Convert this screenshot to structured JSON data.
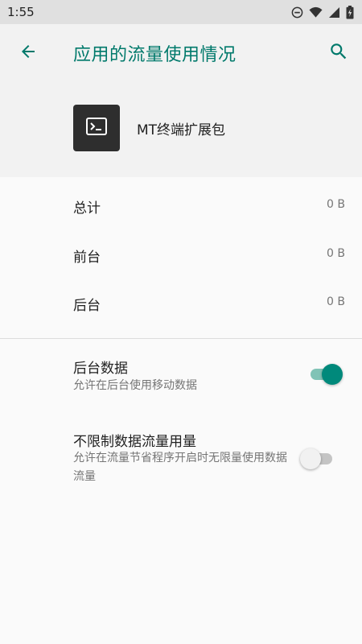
{
  "status_bar": {
    "time": "1:55",
    "icons": [
      "do-not-disturb-icon",
      "wifi-icon",
      "signal-icon",
      "battery-charging-icon"
    ]
  },
  "app_bar": {
    "title": "应用的流量使用情况",
    "back_icon": "arrow-back-icon",
    "search_icon": "search-icon",
    "accent_color": "#00796b"
  },
  "app_header": {
    "app_name": "MT终端扩展包",
    "icon": "terminal-icon"
  },
  "usage": [
    {
      "label": "总计",
      "value": "0 B"
    },
    {
      "label": "前台",
      "value": "0 B"
    },
    {
      "label": "后台",
      "value": "0 B"
    }
  ],
  "settings": {
    "background_data": {
      "title": "后台数据",
      "summary": "允许在后台使用移动数据",
      "enabled": true
    },
    "unrestricted_data": {
      "title": "不限制数据流量用量",
      "summary": "允许在流量节省程序开启时无限量使用数据流量",
      "enabled": false
    }
  }
}
